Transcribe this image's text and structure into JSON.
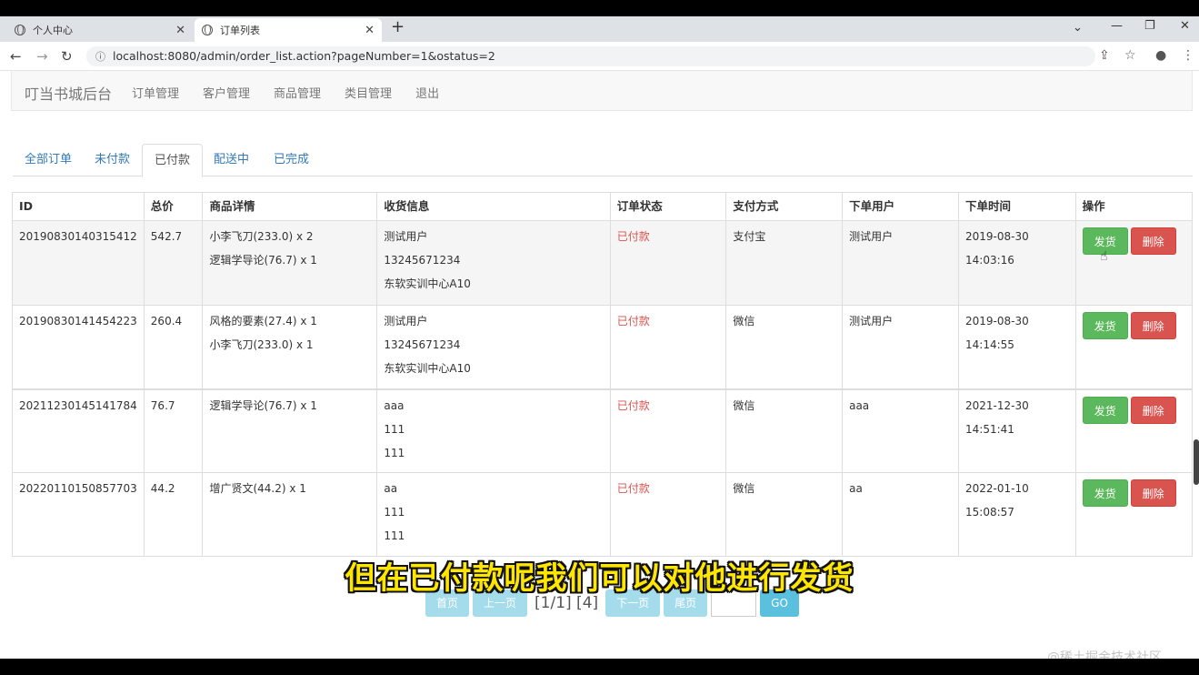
{
  "browser": {
    "tabs": [
      {
        "title": "个人中心"
      },
      {
        "title": "订单列表"
      }
    ],
    "url": "localhost:8080/admin/order_list.action?pageNumber=1&ostatus=2",
    "url_display": "localhost:8080/admin/order_list.action?pageNumber=1&ostatus=2",
    "icons": {
      "back": "←",
      "forward": "→",
      "reload": "↻",
      "new_tab": "+",
      "close": "✕",
      "minimize": "—",
      "maximize": "❐",
      "chevron": "⌄",
      "share": "⇪",
      "star": "☆",
      "profile": "●",
      "menu": "⋮"
    }
  },
  "navbar": {
    "brand": "叮当书城后台",
    "links": [
      "订单管理",
      "客户管理",
      "商品管理",
      "类目管理",
      "退出"
    ]
  },
  "status_tabs": [
    "全部订单",
    "未付款",
    "已付款",
    "配送中",
    "已完成"
  ],
  "table": {
    "headers": [
      "ID",
      "总价",
      "商品详情",
      "收货信息",
      "订单状态",
      "支付方式",
      "下单用户",
      "下单时间",
      "操作"
    ],
    "rows": [
      {
        "id": "20190830140315412",
        "total": "542.7",
        "items": [
          "小李飞刀(233.0) x 2",
          "逻辑学导论(76.7) x 1"
        ],
        "receiver": [
          "测试用户",
          "13245671234",
          "东软实训中心A10"
        ],
        "status": "已付款",
        "payment": "支付宝",
        "user": "测试用户",
        "time": "2019-08-30 14:03:16"
      },
      {
        "id": "20190830141454223",
        "total": "260.4",
        "items": [
          "风格的要素(27.4) x 1",
          "小李飞刀(233.0) x 1"
        ],
        "receiver": [
          "测试用户",
          "13245671234",
          "东软实训中心A10"
        ],
        "status": "已付款",
        "payment": "微信",
        "user": "测试用户",
        "time": "2019-08-30 14:14:55"
      },
      {
        "id": "20211230145141784",
        "total": "76.7",
        "items": [
          "逻辑学导论(76.7) x 1"
        ],
        "receiver": [
          "aaa",
          "111",
          "111"
        ],
        "status": "已付款",
        "payment": "微信",
        "user": "aaa",
        "time": "2021-12-30 14:51:41"
      },
      {
        "id": "20220110150857703",
        "total": "44.2",
        "items": [
          "增广贤文(44.2) x 1"
        ],
        "receiver": [
          "aa",
          "111",
          "111"
        ],
        "status": "已付款",
        "payment": "微信",
        "user": "aa",
        "time": "2022-01-10 15:08:57"
      }
    ],
    "actions": {
      "ship": "发货",
      "delete": "删除"
    }
  },
  "pager": {
    "first": "首页",
    "prev": "上一页",
    "info": "[1/1] [4]",
    "next": "下一页",
    "last": "尾页",
    "go": "GO"
  },
  "subtitle": "但在已付款呢我们可以对他进行发货",
  "watermark": "@稀土掘金技术社区",
  "colors": {
    "ship": "#5cb85c",
    "delete": "#d9534f",
    "link": "#337ab7",
    "status_paid": "#d9534f"
  }
}
